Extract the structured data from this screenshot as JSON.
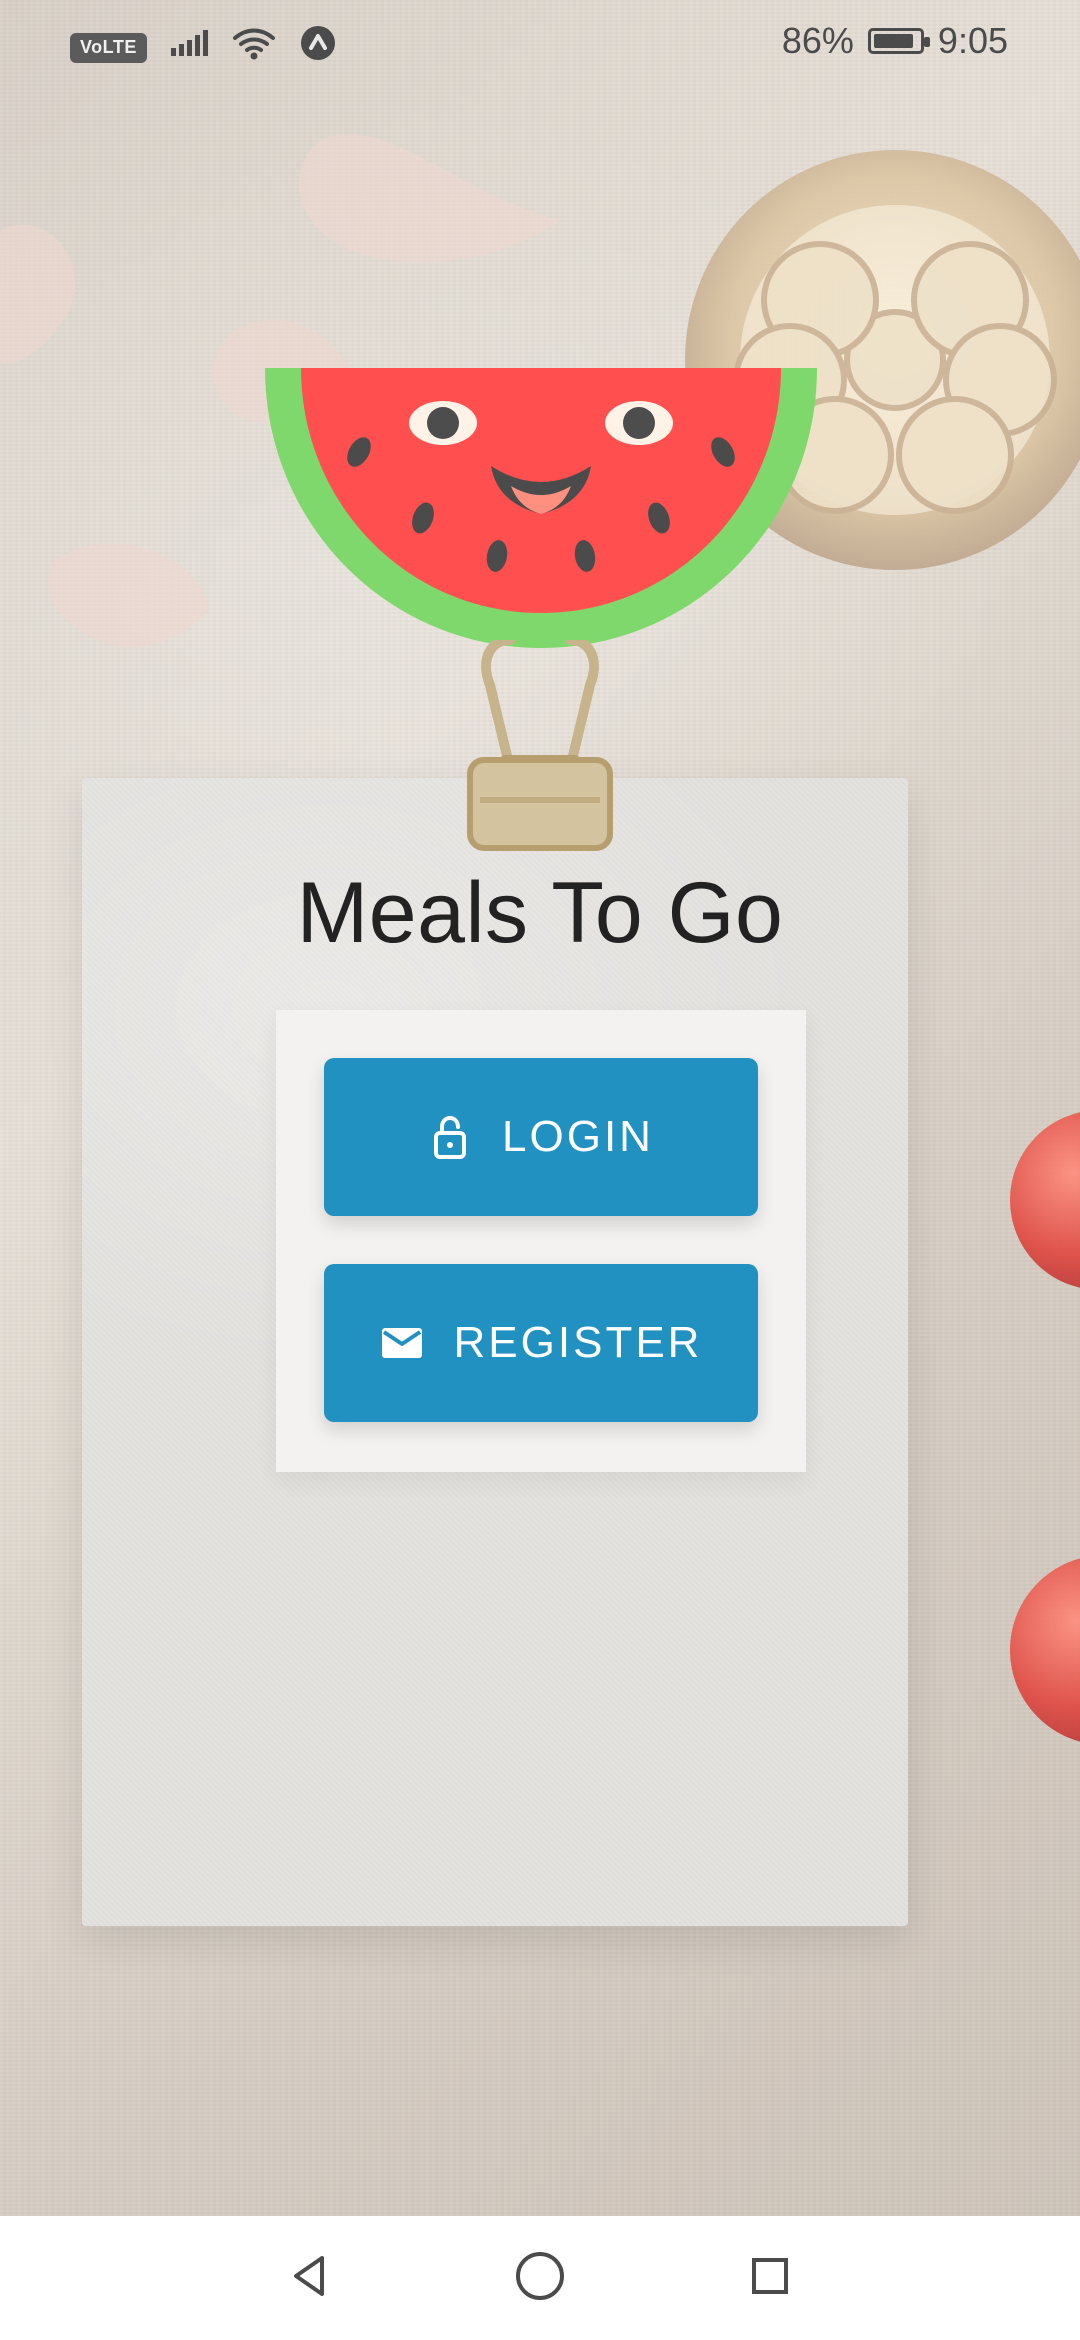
{
  "status_bar": {
    "volte": "VoLTE",
    "battery_percent": "86%",
    "time": "9:05",
    "icons": [
      "signal-icon",
      "wifi-icon",
      "app-indicator-icon",
      "battery-icon"
    ]
  },
  "app": {
    "title": "Meals To Go"
  },
  "actions": {
    "login_label": "LOGIN",
    "register_label": "REGISTER",
    "login_icon": "lock-icon",
    "register_icon": "mail-icon",
    "button_color": "#2191c2"
  },
  "navigation": {
    "icons": [
      "back-icon",
      "home-icon",
      "recent-apps-icon"
    ]
  }
}
